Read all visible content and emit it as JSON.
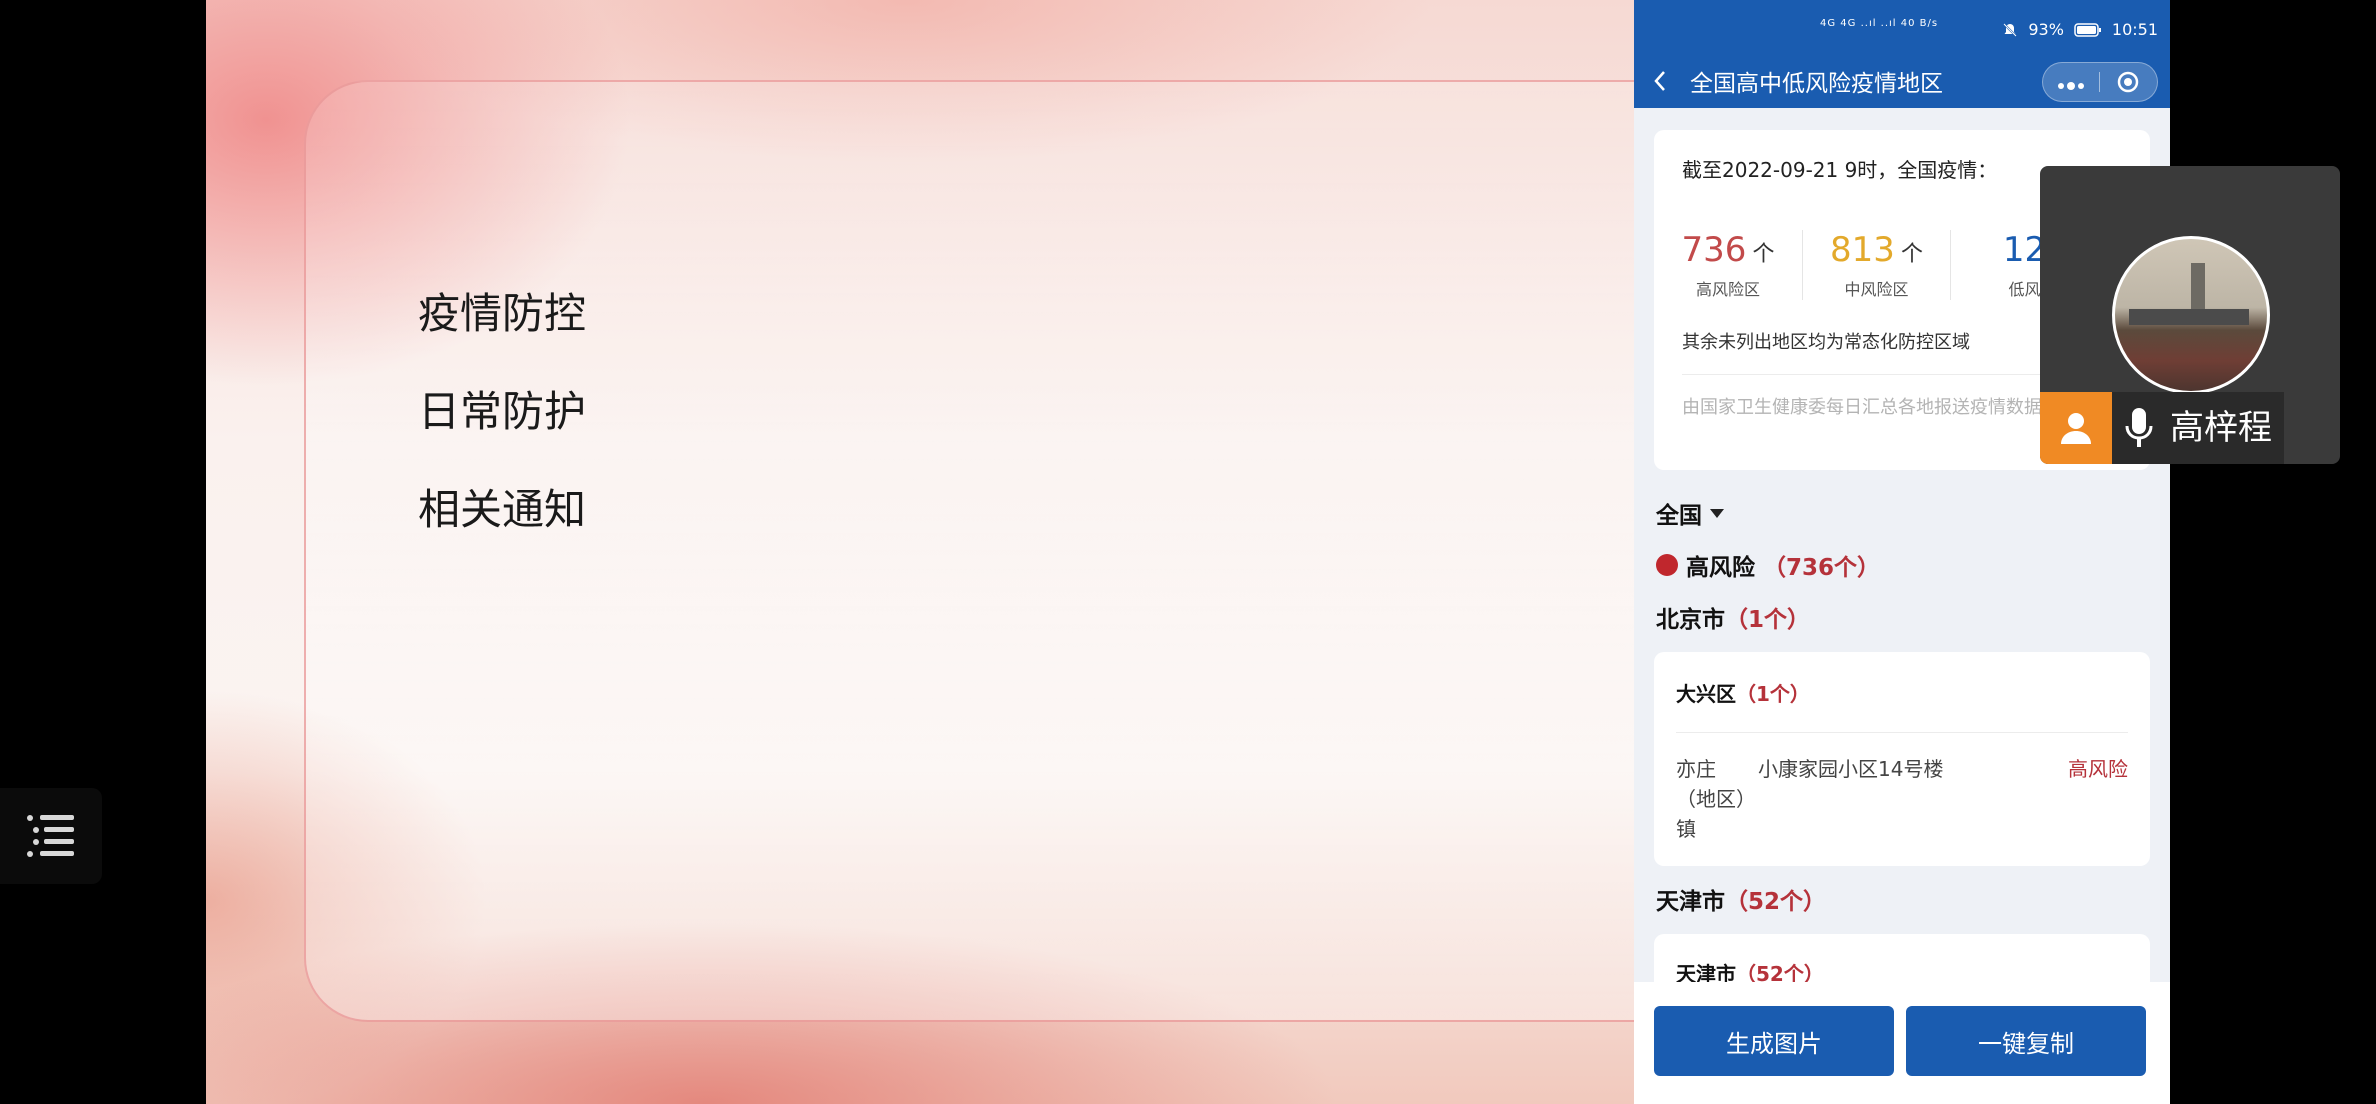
{
  "slide": {
    "menu": [
      "疫情防控",
      "日常防护",
      "相关通知"
    ]
  },
  "status_bar": {
    "signal_text": "4G 4G ..ıl ..ıl 40 B/s",
    "battery": "93%",
    "time": "10:51"
  },
  "nav": {
    "back_icon": "chevron-left-icon",
    "title": "全国高中低风险疫情地区",
    "more_icon": "more-dots-icon",
    "target_icon": "target-icon"
  },
  "summary": {
    "date_text": "截至2022-09-21 9时，全国疫情：",
    "stats": [
      {
        "value": "736",
        "label": "高风险区",
        "color": "#c24a4a"
      },
      {
        "value": "813",
        "label": "中风险区",
        "color": "#e3a92b"
      },
      {
        "value": "12",
        "label": "低风",
        "color": "#1a5cb0"
      }
    ],
    "arrow": "个",
    "note": "其余未列出地区均为常态化防控区域",
    "source": "由国家卫生健康委每日汇总各地报送疫情数据"
  },
  "region": {
    "selected": "全国"
  },
  "risk": {
    "label": "高风险",
    "count": "（736个）",
    "color": "#c0272d"
  },
  "cities": [
    {
      "name": "北京市",
      "count": "（1个）",
      "district": {
        "name": "大兴区",
        "count": "（1个）",
        "street": "亦庄（地区）镇",
        "address": "小康家园小区14号楼",
        "level": "高风险"
      }
    },
    {
      "name": "天津市",
      "count": "（52个）",
      "district": {
        "name": "天津市",
        "count": "（52个）"
      }
    }
  ],
  "buttons": {
    "generate": "生成图片",
    "copy": "一键复制"
  },
  "video": {
    "name": "高梓程"
  },
  "colors": {
    "primary": "#1a5cb0",
    "danger": "#b5323a",
    "accent_orange": "#f08a24"
  }
}
